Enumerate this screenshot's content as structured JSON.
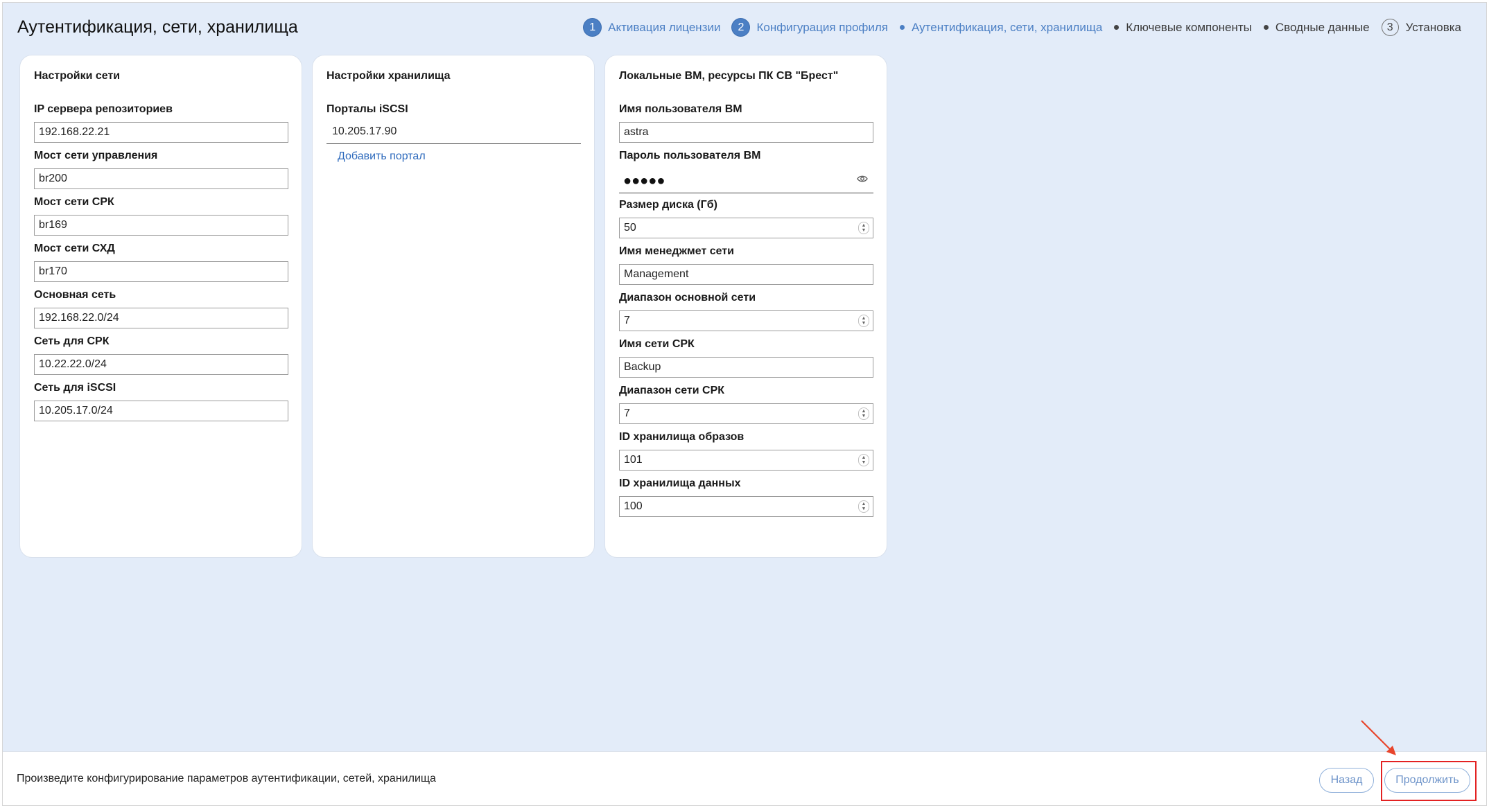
{
  "page": {
    "title": "Аутентификация, сети, хранилища"
  },
  "stepper": [
    {
      "kind": "number",
      "num": "1",
      "label": "Активация лицензии",
      "state": "done"
    },
    {
      "kind": "number",
      "num": "2",
      "label": "Конфигурация профиля",
      "state": "done"
    },
    {
      "kind": "dot",
      "label": "Аутентификация, сети, хранилища",
      "state": "current"
    },
    {
      "kind": "dot",
      "label": "Ключевые компоненты",
      "state": "pending"
    },
    {
      "kind": "dot",
      "label": "Сводные данные",
      "state": "pending"
    },
    {
      "kind": "number",
      "num": "3",
      "label": "Установка",
      "state": "pending"
    }
  ],
  "network": {
    "title": "Настройки сети",
    "fields": [
      {
        "label": "IP сервера репозиториев",
        "value": "192.168.22.21"
      },
      {
        "label": "Мост сети управления",
        "value": "br200"
      },
      {
        "label": "Мост сети СРК",
        "value": "br169"
      },
      {
        "label": "Мост сети СХД",
        "value": "br170"
      },
      {
        "label": "Основная сеть",
        "value": "192.168.22.0/24"
      },
      {
        "label": "Сеть для СРК",
        "value": "10.22.22.0/24"
      },
      {
        "label": "Сеть для iSCSI",
        "value": "10.205.17.0/24"
      }
    ]
  },
  "storage": {
    "title": "Настройки хранилища",
    "portals_label": "Порталы iSCSI",
    "portal_value": "10.205.17.90",
    "add_portal": "Добавить портал"
  },
  "vm": {
    "title": "Локальные ВМ, ресурсы ПК СВ \"Брест\"",
    "fields": [
      {
        "label": "Имя пользователя ВМ",
        "value": "astra"
      },
      {
        "label": "Пароль пользователя ВМ",
        "value": "●●●●●"
      },
      {
        "label": "Размер диска (Гб)",
        "value": "50"
      },
      {
        "label": "Имя менеджмет сети",
        "value": "Management"
      },
      {
        "label": "Диапазон основной сети",
        "value": "7"
      },
      {
        "label": "Имя сети СРК",
        "value": "Backup"
      },
      {
        "label": "Диапазон сети СРК",
        "value": "7"
      },
      {
        "label": "ID хранилища образов",
        "value": "101"
      },
      {
        "label": "ID хранилища данных",
        "value": "100"
      }
    ]
  },
  "footer": {
    "text": "Произведите конфигурирование параметров аутентификации, сетей, хранилища",
    "back_label": "Назад",
    "next_label": "Продолжить"
  },
  "colors": {
    "accent": "#4b7fc4",
    "highlight": "#e32222",
    "background": "#e3ecf9"
  }
}
